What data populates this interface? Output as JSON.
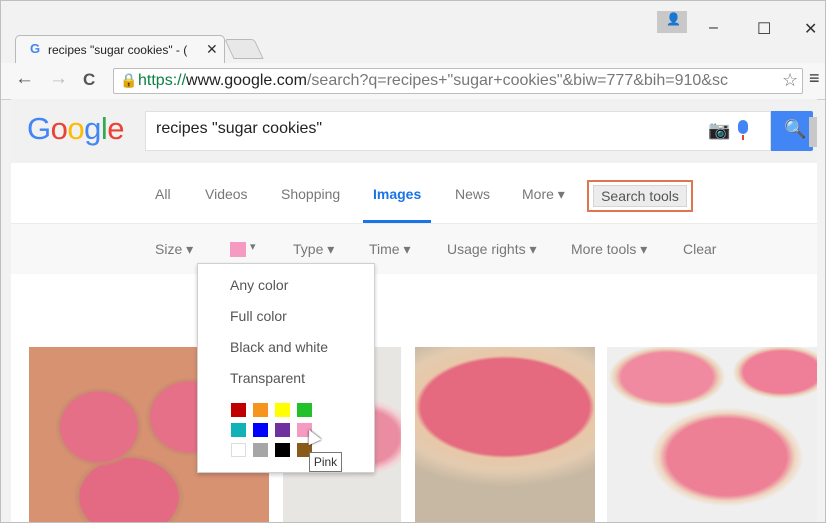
{
  "browser": {
    "tab_title": "recipes \"sugar cookies\" - (",
    "tab_close": "✕",
    "tab_favicon": "G",
    "window_buttons": [
      "–",
      "☐",
      "✕"
    ],
    "url_scheme": "https://",
    "url_host": "www.google.com",
    "url_path": "/search?q=recipes+\"sugar+cookies\"&biw=777&bih=910&sc",
    "nav": {
      "back": "←",
      "forward": "→",
      "reload": "C"
    }
  },
  "search": {
    "logo_letters": [
      {
        "ch": "G",
        "color": "#4285f4"
      },
      {
        "ch": "o",
        "color": "#ea4335"
      },
      {
        "ch": "o",
        "color": "#fbbc05"
      },
      {
        "ch": "g",
        "color": "#4285f4"
      },
      {
        "ch": "l",
        "color": "#34a853"
      },
      {
        "ch": "e",
        "color": "#ea4335"
      }
    ],
    "query": "recipes \"sugar cookies\"",
    "icons": [
      "camera-icon",
      "microphone-icon",
      "search-icon"
    ]
  },
  "tabs": [
    {
      "label": "All"
    },
    {
      "label": "Videos"
    },
    {
      "label": "Shopping"
    },
    {
      "label": "Images",
      "active": true
    },
    {
      "label": "News"
    },
    {
      "label": "More ▾"
    }
  ],
  "search_tools_label": "Search tools",
  "tools": {
    "size": "Size ▾",
    "type": "Type ▾",
    "time": "Time ▾",
    "usage_rights": "Usage rights ▾",
    "more_tools": "More tools ▾",
    "clear": "Clear",
    "selected_color": "#f59ac1"
  },
  "color_menu": {
    "options": [
      "Any color",
      "Full color",
      "Black and white",
      "Transparent"
    ],
    "swatches": [
      [
        "#c00000",
        "#f7941d",
        "#ffff00",
        "#22c02a"
      ],
      [
        "#11b2b7",
        "#0000ff",
        "#7030a0",
        "#f59ac1"
      ],
      [
        "#ffffff",
        "#a6a6a6",
        "#000000",
        "#8a5a19"
      ]
    ],
    "tooltip": "Pink"
  }
}
